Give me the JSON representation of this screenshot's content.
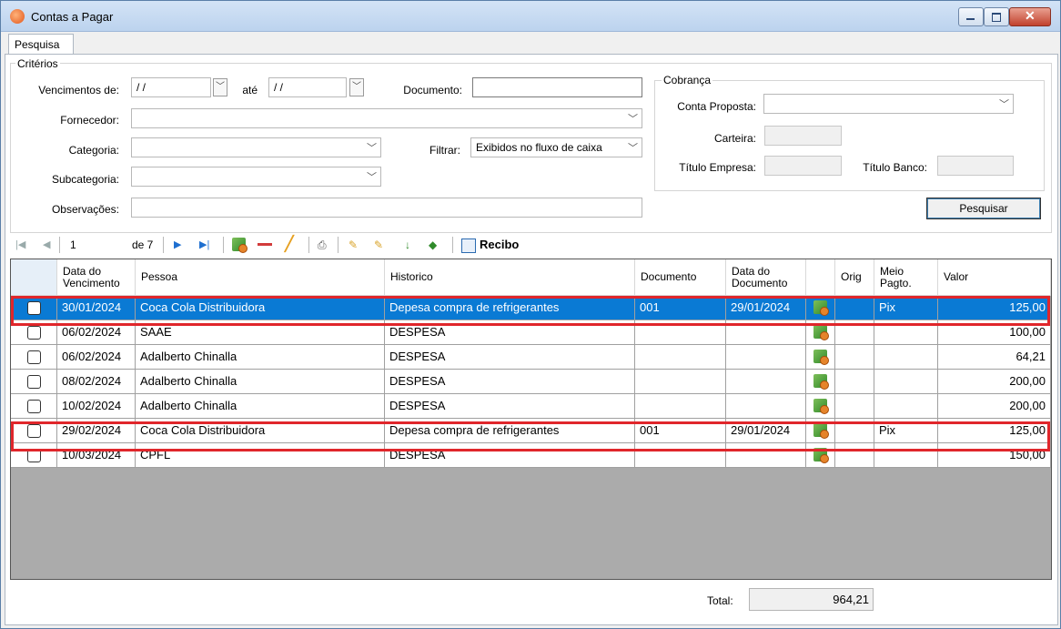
{
  "window": {
    "title": "Contas a Pagar"
  },
  "tabs": [
    {
      "label": "Pesquisa"
    }
  ],
  "criteria": {
    "group_label": "Critérios",
    "vencimentos_label": "Vencimentos de:",
    "vencimento_from": "/ /",
    "ate_label": "até",
    "vencimento_to": "/ /",
    "documento_label": "Documento:",
    "documento_value": "",
    "fornecedor_label": "Fornecedor:",
    "fornecedor_value": "",
    "categoria_label": "Categoria:",
    "categoria_value": "",
    "filtrar_label": "Filtrar:",
    "filtrar_value": "Exibidos no fluxo de caixa",
    "subcategoria_label": "Subcategoria:",
    "subcategoria_value": "",
    "observacoes_label": "Observações:",
    "observacoes_value": ""
  },
  "cobranca": {
    "group_label": "Cobrança",
    "conta_proposta_label": "Conta Proposta:",
    "conta_proposta_value": "",
    "carteira_label": "Carteira:",
    "titulo_empresa_label": "Título Empresa:",
    "titulo_banco_label": "Título Banco:"
  },
  "pesquisar_button": "Pesquisar",
  "navigator": {
    "position": "1",
    "count_label": "de 7",
    "recibo_label": "Recibo"
  },
  "grid": {
    "columns": [
      {
        "label": ""
      },
      {
        "label": "Data do Vencimento"
      },
      {
        "label": "Pessoa"
      },
      {
        "label": "Historico"
      },
      {
        "label": "Documento"
      },
      {
        "label": "Data do Documento"
      },
      {
        "label": ""
      },
      {
        "label": "Orig"
      },
      {
        "label": "Meio Pagto."
      },
      {
        "label": "Valor"
      }
    ],
    "rows": [
      {
        "vencimento": "30/01/2024",
        "pessoa": "Coca Cola Distribuidora",
        "historico": "Depesa compra de refrigerantes",
        "documento": "001",
        "data_documento": "29/01/2024",
        "orig": "",
        "meio": "Pix",
        "valor": "125,00",
        "selected": true,
        "highlighted": true
      },
      {
        "vencimento": "06/02/2024",
        "pessoa": "SAAE",
        "historico": "DESPESA",
        "documento": "",
        "data_documento": "",
        "orig": "",
        "meio": "",
        "valor": "100,00",
        "selected": false,
        "highlighted": false
      },
      {
        "vencimento": "06/02/2024",
        "pessoa": "Adalberto Chinalla",
        "historico": "DESPESA",
        "documento": "",
        "data_documento": "",
        "orig": "",
        "meio": "",
        "valor": "64,21",
        "selected": false,
        "highlighted": false
      },
      {
        "vencimento": "08/02/2024",
        "pessoa": "Adalberto Chinalla",
        "historico": "DESPESA",
        "documento": "",
        "data_documento": "",
        "orig": "",
        "meio": "",
        "valor": "200,00",
        "selected": false,
        "highlighted": false
      },
      {
        "vencimento": "10/02/2024",
        "pessoa": "Adalberto Chinalla",
        "historico": "DESPESA",
        "documento": "",
        "data_documento": "",
        "orig": "",
        "meio": "",
        "valor": "200,00",
        "selected": false,
        "highlighted": false
      },
      {
        "vencimento": "29/02/2024",
        "pessoa": "Coca Cola Distribuidora",
        "historico": "Depesa compra de refrigerantes",
        "documento": "001",
        "data_documento": "29/01/2024",
        "orig": "",
        "meio": "Pix",
        "valor": "125,00",
        "selected": false,
        "highlighted": true
      },
      {
        "vencimento": "10/03/2024",
        "pessoa": "CPFL",
        "historico": "DESPESA",
        "documento": "",
        "data_documento": "",
        "orig": "",
        "meio": "",
        "valor": "150,00",
        "selected": false,
        "highlighted": false
      }
    ]
  },
  "footer": {
    "total_label": "Total:",
    "total_value": "964,21"
  },
  "colors": {
    "selection": "#0a7ad4",
    "highlight": "#e0262b"
  }
}
